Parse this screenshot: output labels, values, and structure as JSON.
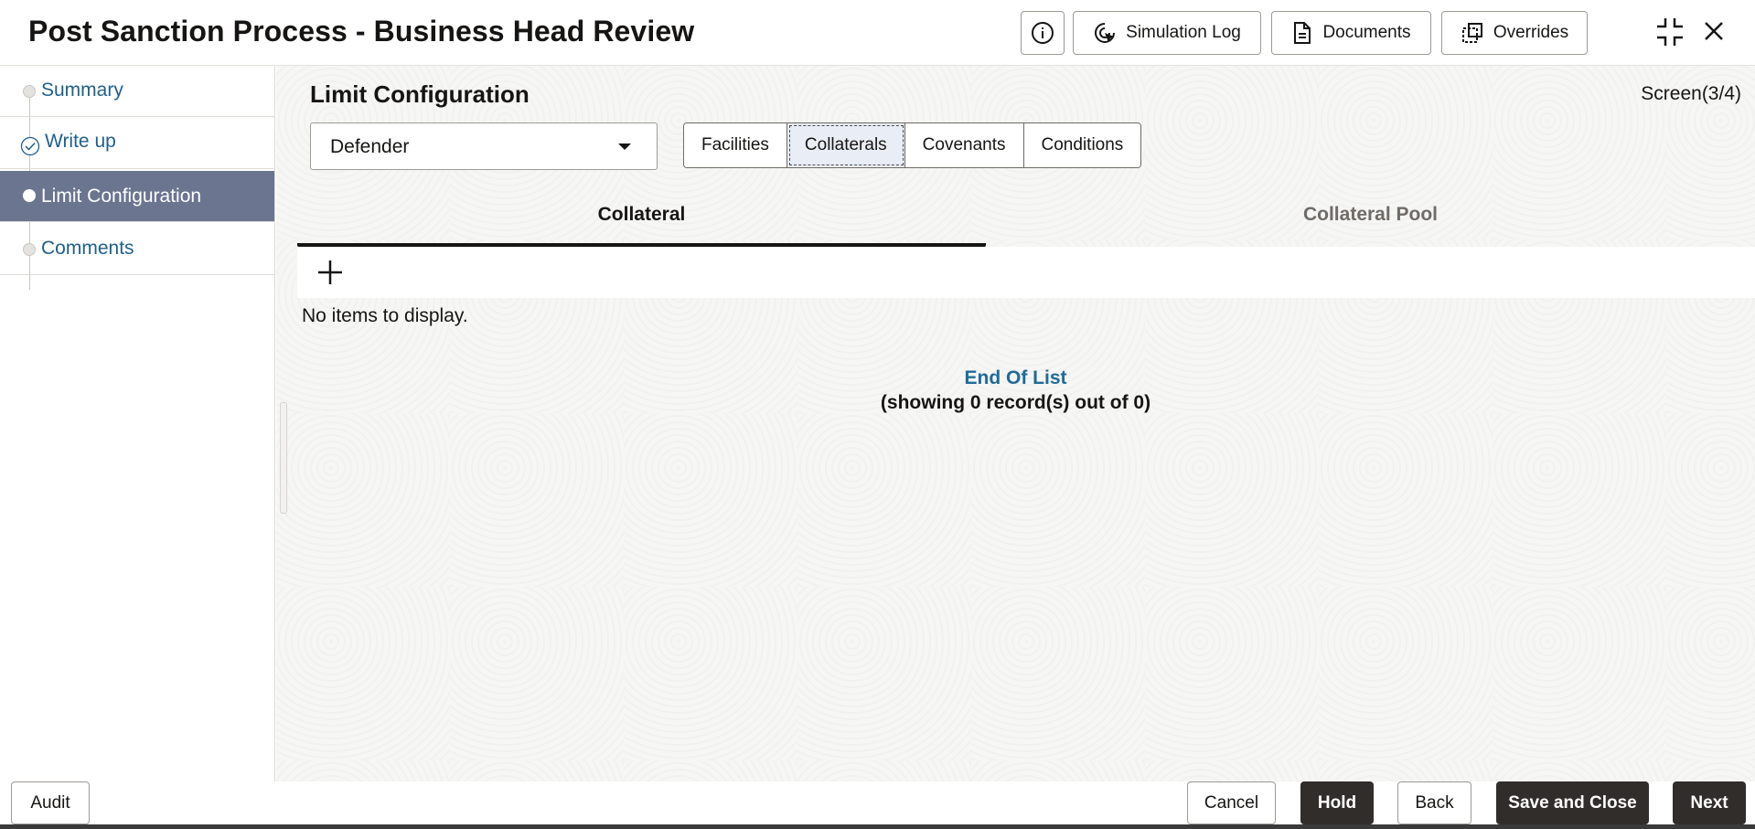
{
  "header": {
    "title": "Post Sanction Process - Business Head Review",
    "buttons": {
      "info_icon": "info-icon",
      "simulation_log": "Simulation Log",
      "documents": "Documents",
      "overrides": "Overrides"
    }
  },
  "sidebar": {
    "items": [
      {
        "label": "Summary",
        "state": "pending"
      },
      {
        "label": "Write up",
        "state": "completed"
      },
      {
        "label": "Limit Configuration",
        "state": "active"
      },
      {
        "label": "Comments",
        "state": "pending"
      }
    ]
  },
  "main": {
    "title": "Limit Configuration",
    "screen_counter": "Screen(3/4)",
    "customer_select": {
      "value": "Defender"
    },
    "segments": [
      "Facilities",
      "Collaterals",
      "Covenants",
      "Conditions"
    ],
    "selected_segment": "Collaterals",
    "subtabs": [
      "Collateral",
      "Collateral Pool"
    ],
    "active_subtab": "Collateral",
    "empty_message": "No items to display.",
    "end_of_list": "End Of List",
    "record_count": "(showing 0 record(s) out of 0)"
  },
  "footer": {
    "audit": "Audit",
    "cancel": "Cancel",
    "hold": "Hold",
    "back": "Back",
    "save_close": "Save and Close",
    "next": "Next"
  },
  "colors": {
    "active_step_bg": "#6b7590",
    "link_blue": "#1f5f8b",
    "primary_dark_button": "#312d2a"
  }
}
